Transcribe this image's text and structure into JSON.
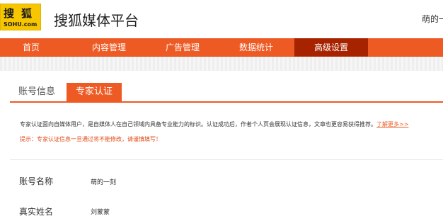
{
  "header": {
    "logo_cn": "搜狐",
    "logo_en": "SOHU.com",
    "title": "搜狐媒体平台",
    "user": "萌的一"
  },
  "nav": {
    "items": [
      {
        "label": "首页"
      },
      {
        "label": "内容管理"
      },
      {
        "label": "广告管理"
      },
      {
        "label": "数据统计"
      },
      {
        "label": "高级设置"
      }
    ],
    "active_index": 4
  },
  "tabs": [
    {
      "label": "账号信息"
    },
    {
      "label": "专家认证"
    }
  ],
  "notice": {
    "text": "专家认证面向自媒体用户，是自媒体人在自己领域内具备专业能力的标识。认证成功后，作者个人页会展现认证信息，文章也更容易获得推荐。",
    "link": "了解更多>>",
    "warning": "提示：专家认证信息一旦通过将不能修改，请谨慎填写！"
  },
  "form": {
    "rows": [
      {
        "label": "账号名称",
        "value": "萌的一刻"
      },
      {
        "label": "真实姓名",
        "value": "刘蒙蒙"
      }
    ]
  },
  "colors": {
    "accent": "#ee5a24",
    "nav_active": "#a72300",
    "logo_bg": "#f7c600"
  }
}
